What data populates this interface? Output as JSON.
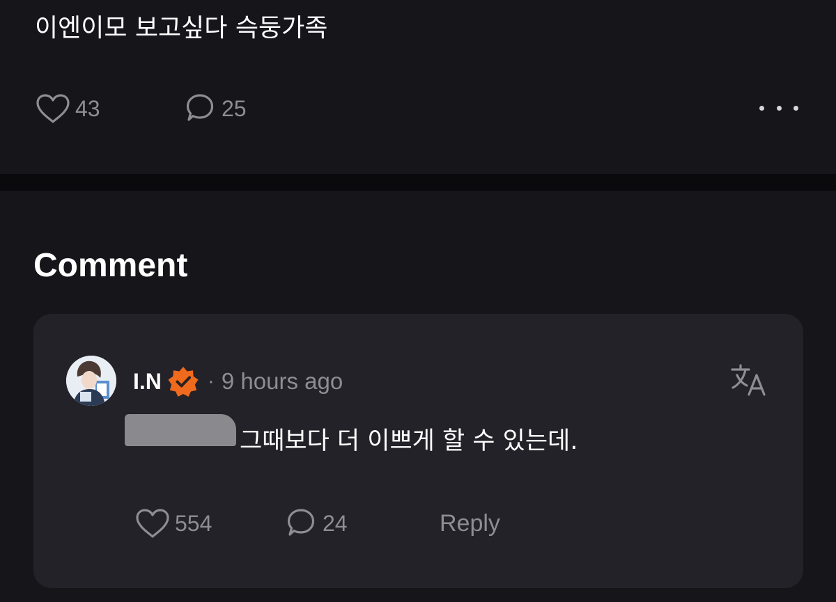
{
  "post": {
    "text": "이엔이모 보고싶다 슥둥가족",
    "likes": "43",
    "comments": "25",
    "more_icon": "more-horizontal-icon"
  },
  "comments_section": {
    "heading": "Comment",
    "comment": {
      "author": "I.N",
      "verified": true,
      "separator": "·",
      "timestamp": "9 hours ago",
      "text": "그때보다 더 이쁘게 할 수 있는데.",
      "likes": "554",
      "replies": "24",
      "reply_label": "Reply",
      "translate_icon": "translate-icon"
    }
  },
  "colors": {
    "background": "#16151a",
    "card": "#232229",
    "muted": "#8e8d94",
    "verified_badge": "#f06a1d"
  }
}
